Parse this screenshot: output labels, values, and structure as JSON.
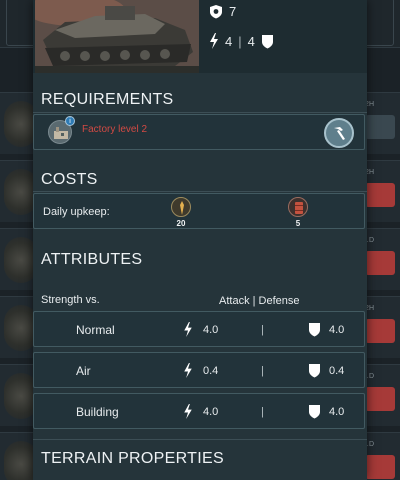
{
  "background": {
    "rows": [
      {
        "tag": "…2H",
        "button": "…CE"
      },
      {
        "tag": "…2H",
        "button": "…CE",
        "red": true
      },
      {
        "tag": "…D",
        "button": "…CE",
        "red": true
      },
      {
        "tag": "…2H",
        "button": "…CE",
        "red": true
      },
      {
        "tag": "…D",
        "button": "…CE",
        "red": true
      },
      {
        "tag": "…D",
        "button": "…CE",
        "red": true
      }
    ]
  },
  "unit": {
    "image_icon": "tank-image",
    "defense_value": "7",
    "attack_value": "4",
    "separator": "|",
    "attack_value_2": "4"
  },
  "requirements": {
    "title": "REQUIREMENTS",
    "items": [
      {
        "icon": "factory-icon",
        "badge": "i",
        "text": "Factory level 2",
        "action_icon": "hammer-icon"
      }
    ]
  },
  "costs": {
    "title": "COSTS",
    "label": "Daily upkeep:",
    "resources": [
      {
        "icon": "grain-icon",
        "value": "20"
      },
      {
        "icon": "fuel-barrel-icon",
        "value": "5"
      }
    ]
  },
  "attributes": {
    "title": "ATTRIBUTES",
    "strength_label": "Strength vs.",
    "header": "Attack | Defense",
    "rows": [
      {
        "name": "Normal",
        "attack": "4.0",
        "separator": "|",
        "defense": "4.0"
      },
      {
        "name": "Air",
        "attack": "0.4",
        "separator": "|",
        "defense": "0.4"
      },
      {
        "name": "Building",
        "attack": "4.0",
        "separator": "|",
        "defense": "4.0"
      }
    ]
  },
  "terrain": {
    "title": "TERRAIN PROPERTIES"
  },
  "colors": {
    "modal_bg": "#25343a",
    "requirement_text": "#d24a44",
    "accent_button": "#5f7f8c",
    "bg_red_button": "#a63a38"
  }
}
